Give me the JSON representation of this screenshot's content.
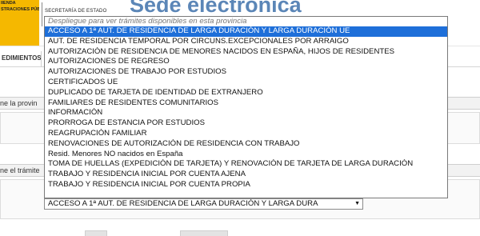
{
  "header": {
    "logo_lines": [
      "",
      "IIENDA",
      "STRACIONES PÚBLICAS"
    ],
    "secretaria": "SECRETARÍA DE ESTADO",
    "title": "Sede electrónica"
  },
  "nav": {
    "tab_label": "EDIMIENTOS"
  },
  "form": {
    "province_label_fragment": "ne la provin",
    "procedure_label_fragment": "ne el trámite"
  },
  "dropdown": {
    "placeholder": "Despliegue para ver trámites disponibles en esta provincia",
    "options": [
      "ACCESO A 1ª AUT. DE RESIDENCIA DE LARGA DURACIÓN Y LARGA DURACIÓN UE",
      "AUT. DE RESIDENCIA TEMPORAL POR CIRCUNS.EXCEPCIONALES POR ARRAIGO",
      "AUTORIZACIÓN DE RESIDENCIA DE MENORES NACIDOS EN ESPAÑA, HIJOS DE RESIDENTES",
      "AUTORIZACIONES DE REGRESO",
      "AUTORIZACIONES DE TRABAJO POR ESTUDIOS",
      "CERTIFICADOS UE",
      "DUPLICADO DE TARJETA DE IDENTIDAD DE EXTRANJERO",
      "FAMILIARES DE RESIDENTES COMUNITARIOS",
      "INFORMACIÓN",
      "PRORROGA DE ESTANCIA POR ESTUDIOS",
      "REAGRUPACIÓN FAMILIAR",
      "RENOVACIONES DE AUTORIZACIÓN DE RESIDENCIA CON TRABAJO",
      "Resid. Menores NO nacidos en España",
      "TOMA DE HUELLAS (EXPEDICIÓN DE TARJETA) Y RENOVACIÓN DE TARJETA DE LARGA DURACIÓN",
      "TRABAJO Y RESIDENCIA INICIAL POR CUENTA AJENA",
      "TRABAJO Y RESIDENCIA INICIAL POR CUENTA PROPIA"
    ],
    "selected_index": 0,
    "selected_value": "ACCESO A 1ª AUT. DE RESIDENCIA DE LARGA DURACIÓN Y LARGA DURA",
    "arrow_glyph": "▼"
  },
  "colors": {
    "header_yellow": "#f5b800",
    "title_blue": "#5b86b7",
    "selection_blue": "#1e6fd9"
  }
}
